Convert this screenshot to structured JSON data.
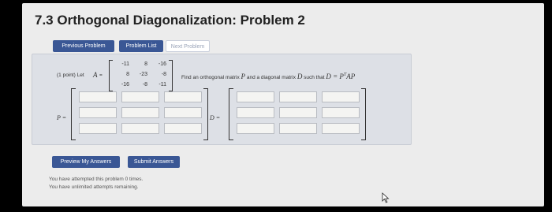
{
  "page": {
    "title": "7.3 Orthogonal Diagonalization: Problem 2"
  },
  "nav": {
    "previous": "Previous Problem",
    "list": "Problem List",
    "next": "Next Problem"
  },
  "problem": {
    "points_label": "(1 point) Let",
    "matrix_name": "A",
    "equals": "=",
    "matrix_A": [
      [
        "-11",
        "8",
        "-16"
      ],
      [
        "8",
        "-23",
        "-8"
      ],
      [
        "-16",
        "-8",
        "-11"
      ]
    ],
    "instruction": "Find an orthogonal matrix",
    "P": "P",
    "and_text": "and a diagonal matrix",
    "D": "D",
    "such_that": "such that",
    "equation": "D = P",
    "sup": "T",
    "equation_tail": "AP"
  },
  "answer": {
    "P_label": "P =",
    "D_label": "D ="
  },
  "buttons": {
    "preview": "Preview My Answers",
    "submit": "Submit Answers"
  },
  "status": {
    "attempts": "You have attempted this problem 0 times.",
    "remaining": "You have unlimited attempts remaining."
  },
  "icons": {
    "cursor": "mouse-pointer-icon"
  }
}
